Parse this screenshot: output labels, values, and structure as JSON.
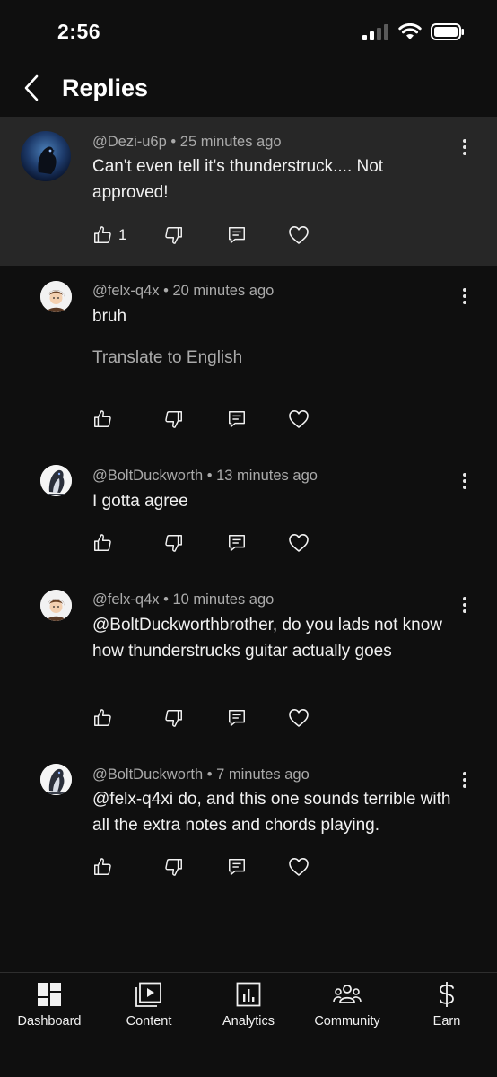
{
  "status": {
    "time": "2:56"
  },
  "header": {
    "title": "Replies"
  },
  "comments": [
    {
      "handle": "@Dezi-u6p",
      "sep": "•",
      "time": "25 minutes ago",
      "text": "Can't even tell it's thunderstruck.... Not approved!",
      "likes": "1"
    },
    {
      "handle": "@felx-q4x",
      "sep": "•",
      "time": "20 minutes ago",
      "text": "bruh",
      "translate": "Translate to English"
    },
    {
      "handle": "@BoltDuckworth",
      "sep": "•",
      "time": "13 minutes ago",
      "text": "I gotta agree"
    },
    {
      "handle": "@felx-q4x",
      "sep": "•",
      "time": "10 minutes ago",
      "text": "@BoltDuckworthbrother, do you lads not know how thunderstrucks guitar actually goes"
    },
    {
      "handle": "@BoltDuckworth",
      "sep": "•",
      "time": "7 minutes ago",
      "text": "@felx-q4xi do, and this one sounds terrible with all the extra notes and chords playing."
    }
  ],
  "nav": [
    {
      "label": "Dashboard",
      "icon": "dashboard-icon"
    },
    {
      "label": "Content",
      "icon": "content-icon"
    },
    {
      "label": "Analytics",
      "icon": "analytics-icon"
    },
    {
      "label": "Community",
      "icon": "community-icon"
    },
    {
      "label": "Earn",
      "icon": "dollar-icon"
    }
  ]
}
